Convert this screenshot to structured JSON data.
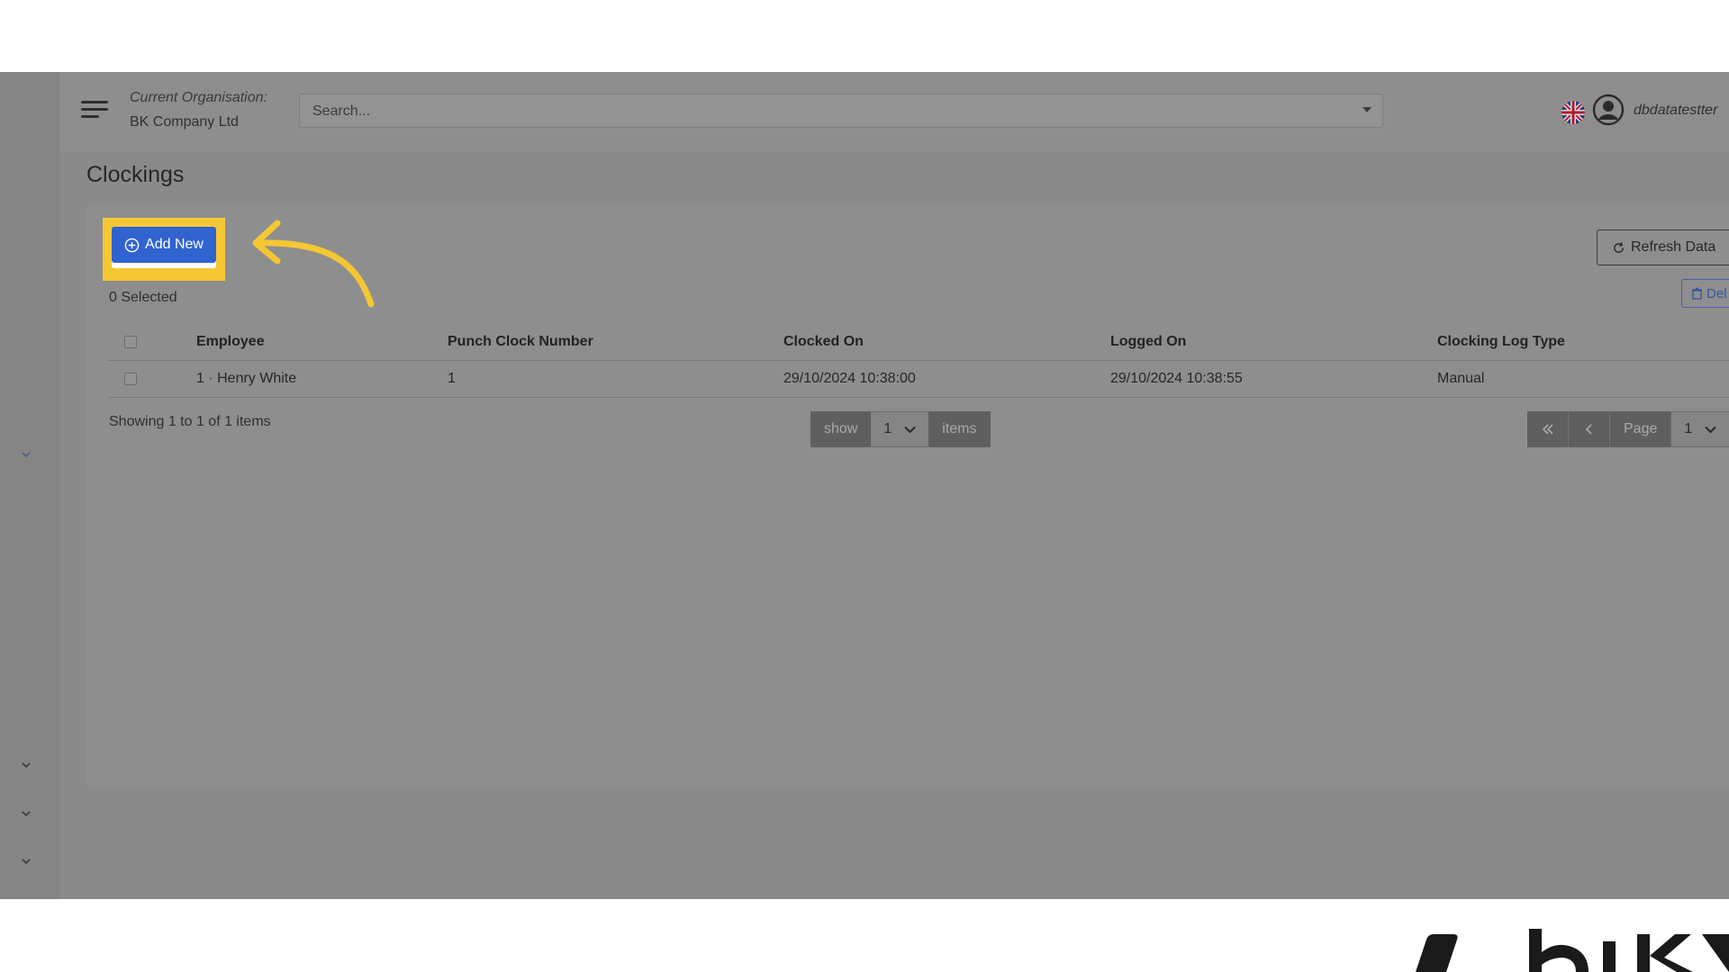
{
  "header": {
    "org_label": "Current Organisation:",
    "org_name": "BK Company Ltd",
    "search_placeholder": "Search...",
    "username": "dbdatatestter"
  },
  "page": {
    "title": "Clockings"
  },
  "toolbar": {
    "add_new_label": "Add New",
    "refresh_label": "Refresh Data",
    "delete_label": "Del",
    "selected_count": "0 Selected"
  },
  "table": {
    "columns": [
      "Employee",
      "Punch Clock Number",
      "Clocked On",
      "Logged On",
      "Clocking Log Type"
    ],
    "rows": [
      {
        "employee": "1 · Henry White",
        "punch_clock_number": "1",
        "clocked_on": "29/10/2024 10:38:00",
        "logged_on": "29/10/2024 10:38:55",
        "clocking_log_type": "Manual"
      }
    ]
  },
  "footer": {
    "showing_text": "Showing 1 to 1 of 1 items",
    "show_label": "show",
    "page_size": "1",
    "items_label": "items",
    "page_label": "Page",
    "current_page": "1"
  },
  "colors": {
    "accent": "#3062d0",
    "highlight": "#f5c735",
    "overlay": "#8a8a8a"
  },
  "icons": {
    "menu": "hamburger-menu-icon",
    "flag": "uk-flag-icon",
    "user": "user-circle-icon",
    "add": "plus-circle-icon",
    "refresh": "refresh-icon",
    "delete": "trash-icon",
    "first": "double-chevron-left-icon",
    "prev": "chevron-left-icon",
    "dropdown": "chevron-down-icon"
  }
}
